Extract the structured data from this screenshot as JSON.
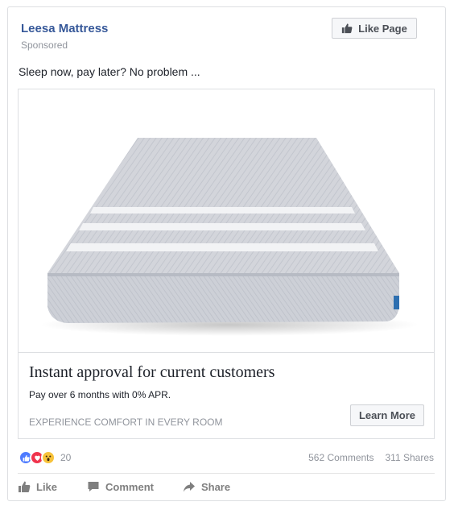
{
  "post": {
    "page_name": "Leesa Mattress",
    "sponsored": "Sponsored",
    "like_page_label": "Like Page",
    "text": "Sleep now, pay later? No problem ..."
  },
  "attachment": {
    "headline": "Instant approval for current customers",
    "description": "Pay over 6 months with 0% APR.",
    "caption": "EXPERIENCE COMFORT IN EVERY ROOM",
    "cta_label": "Learn More",
    "image": "mattress-product-image"
  },
  "engagement": {
    "reactions": [
      "like-reaction-icon",
      "love-reaction-icon",
      "wow-reaction-icon"
    ],
    "reaction_count": "20",
    "comments": "562 Comments",
    "shares": "311 Shares"
  },
  "actions": {
    "like": "Like",
    "comment": "Comment",
    "share": "Share"
  },
  "colors": {
    "link": "#365899",
    "meta": "#90949c",
    "border": "#dddfe2",
    "mattress_top": "#c8cbd3",
    "mattress_stripe": "#f2f3f5"
  }
}
